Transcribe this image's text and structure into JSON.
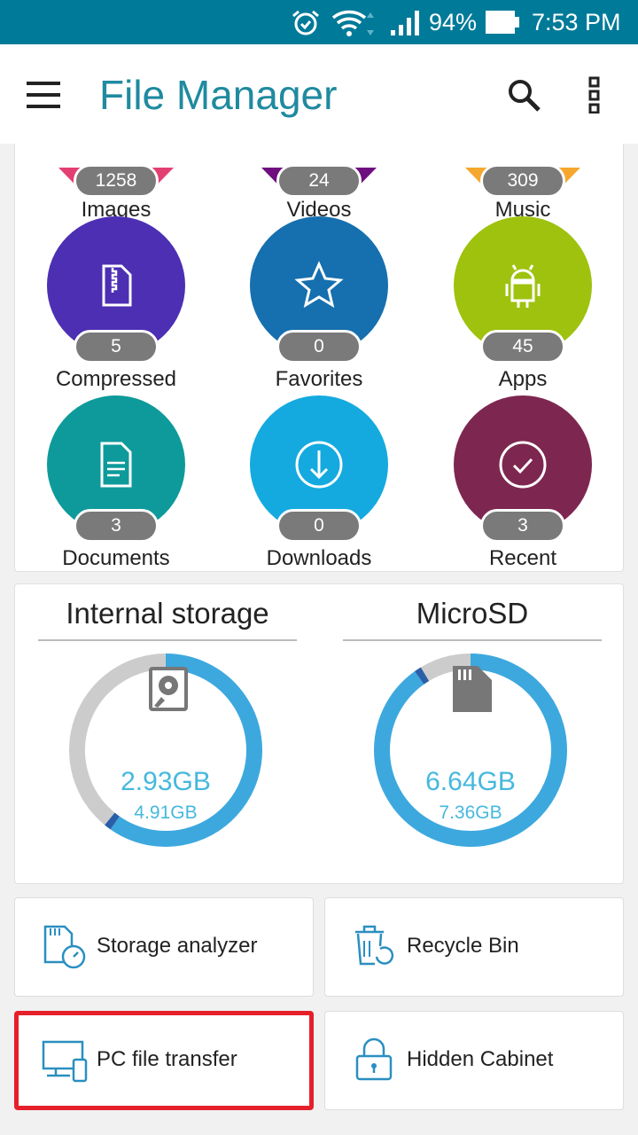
{
  "status_bar": {
    "battery": "94%",
    "time": "7:53 PM",
    "icons": [
      "alarm-icon",
      "wifi-icon",
      "signal-icon",
      "battery-icon"
    ]
  },
  "app_bar": {
    "title": "File Manager",
    "icons": [
      "menu-icon",
      "search-icon",
      "more-icon"
    ]
  },
  "categories": [
    {
      "label": "Images",
      "count": "1258",
      "color": "#e23f72"
    },
    {
      "label": "Videos",
      "count": "24",
      "color": "#6e0e7f"
    },
    {
      "label": "Music",
      "count": "309",
      "color": "#f6a72d"
    },
    {
      "label": "Compressed",
      "count": "5",
      "color": "#4c2fb3",
      "icon": "zip-file-icon"
    },
    {
      "label": "Favorites",
      "count": "0",
      "color": "#166fae",
      "icon": "star-icon"
    },
    {
      "label": "Apps",
      "count": "45",
      "color": "#9ec20e",
      "icon": "android-icon"
    },
    {
      "label": "Documents",
      "count": "3",
      "color": "#0e9a9a",
      "icon": "document-icon"
    },
    {
      "label": "Downloads",
      "count": "0",
      "color": "#14aadf",
      "icon": "download-icon"
    },
    {
      "label": "Recent",
      "count": "3",
      "color": "#7d2750",
      "icon": "check-circle-icon"
    }
  ],
  "storage": [
    {
      "name": "Internal storage",
      "used": "2.93GB",
      "total": "4.91GB",
      "used_fraction": 0.597
    },
    {
      "name": "MicroSD",
      "used": "6.64GB",
      "total": "7.36GB",
      "used_fraction": 0.902
    }
  ],
  "colors": {
    "used": "#3da8de",
    "marker": "#2a5ea8",
    "free": "#cccccc",
    "highlight": "#e5202a"
  },
  "tools": [
    {
      "label": "Storage analyzer",
      "icon": "storage-analyzer-icon"
    },
    {
      "label": "Recycle Bin",
      "icon": "recycle-bin-icon"
    },
    {
      "label": "PC file transfer",
      "icon": "pc-transfer-icon",
      "highlighted": true
    },
    {
      "label": "Hidden Cabinet",
      "icon": "lock-icon"
    }
  ]
}
